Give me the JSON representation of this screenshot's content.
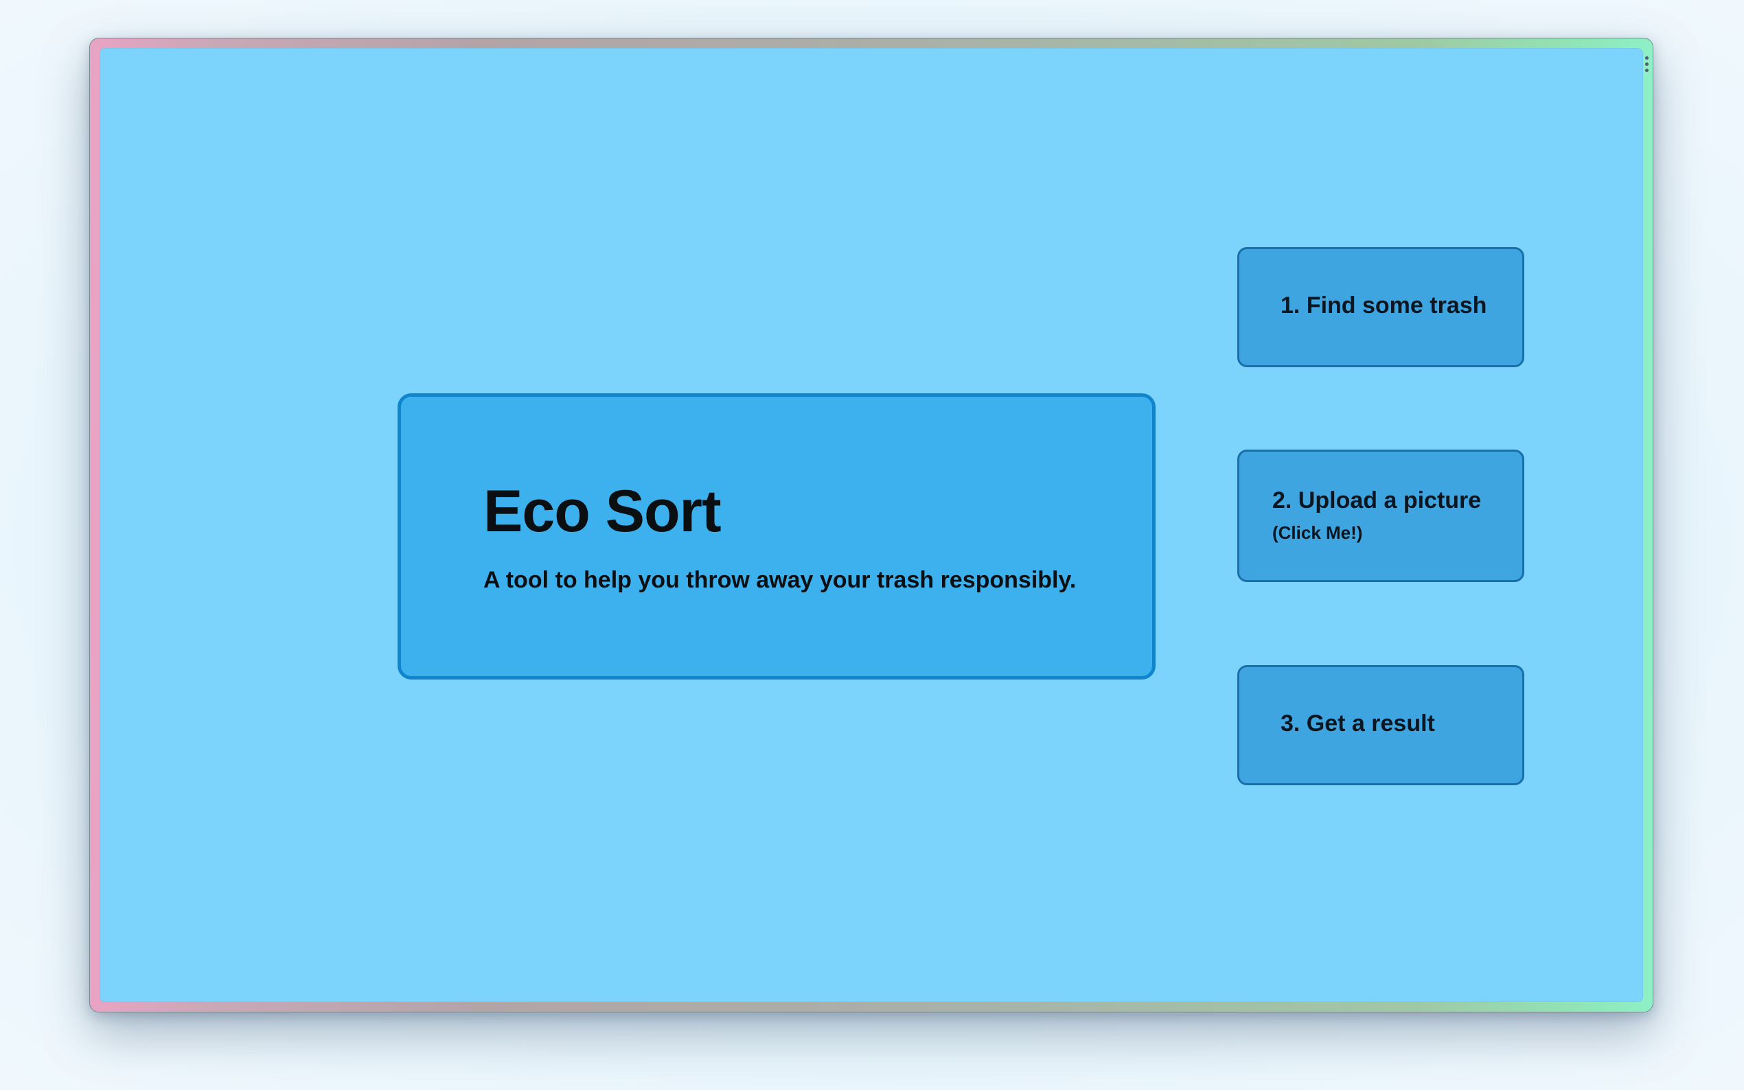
{
  "app": {
    "title": "Eco Sort",
    "subtitle": "A tool to help you throw away your trash responsibly."
  },
  "steps": [
    {
      "label": "1. Find some trash"
    },
    {
      "label": "2. Upload a picture",
      "hint": "(Click Me!)"
    },
    {
      "label": "3. Get a result"
    }
  ],
  "colors": {
    "background": "#7cd3fb",
    "hero_fill": "#3cb1ee",
    "hero_border": "#1185cc",
    "step_fill": "#3ea5e0",
    "step_border": "#1a6fa8",
    "text": "#0c0f12"
  },
  "icons": {
    "window_menu": "vertical-dots-icon"
  }
}
